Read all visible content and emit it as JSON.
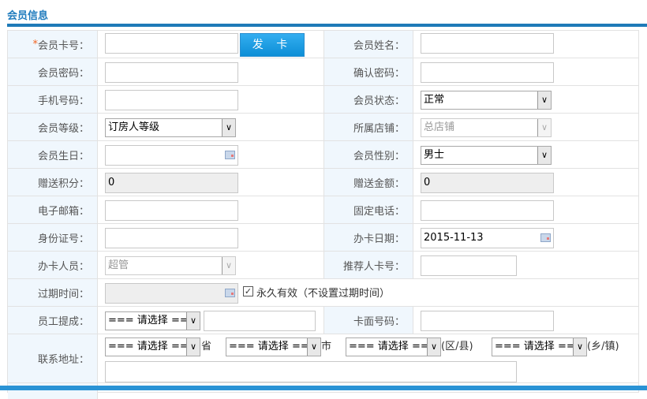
{
  "section_title": "会员信息",
  "card_no": {
    "label": "会员卡号：",
    "required_mark": "*",
    "value": "",
    "issue_button": "发 卡"
  },
  "name": {
    "label": "会员姓名：",
    "value": ""
  },
  "password": {
    "label": "会员密码：",
    "value": ""
  },
  "confirm_password": {
    "label": "确认密码：",
    "value": ""
  },
  "mobile": {
    "label": "手机号码：",
    "value": ""
  },
  "status": {
    "label": "会员状态：",
    "selected": "正常"
  },
  "level": {
    "label": "会员等级：",
    "selected": "订房人等级"
  },
  "store": {
    "label": "所属店铺：",
    "selected": "总店铺"
  },
  "birthday": {
    "label": "会员生日：",
    "value": ""
  },
  "gender": {
    "label": "会员性别：",
    "selected": "男士"
  },
  "bonus_points": {
    "label": "赠送积分：",
    "value": "0"
  },
  "bonus_amount": {
    "label": "赠送金额：",
    "value": "0"
  },
  "email": {
    "label": "电子邮箱：",
    "value": ""
  },
  "phone": {
    "label": "固定电话：",
    "value": ""
  },
  "id_no": {
    "label": "身份证号：",
    "value": ""
  },
  "issue_date": {
    "label": "办卡日期：",
    "value": "2015-11-13"
  },
  "issuer": {
    "label": "办卡人员：",
    "selected": "超管"
  },
  "referrer": {
    "label": "推荐人卡号：",
    "value": ""
  },
  "expiry": {
    "label": "过期时间：",
    "value": "",
    "permanent_checked": true,
    "permanent_label": "永久有效（不设置过期时间）"
  },
  "commission": {
    "label": "员工提成：",
    "selected": "=== 请选择 ===",
    "value": ""
  },
  "card_face_no": {
    "label": "卡面号码：",
    "value": ""
  },
  "address": {
    "label": "联系地址：",
    "province": "=== 请选择 ===",
    "province_suffix": "省",
    "city": "=== 请选择 ===",
    "city_suffix": "市",
    "district": "=== 请选择 ===",
    "district_suffix": "(区/县)",
    "town": "=== 请选择 ===",
    "town_suffix": "(乡/镇)",
    "detail": ""
  }
}
